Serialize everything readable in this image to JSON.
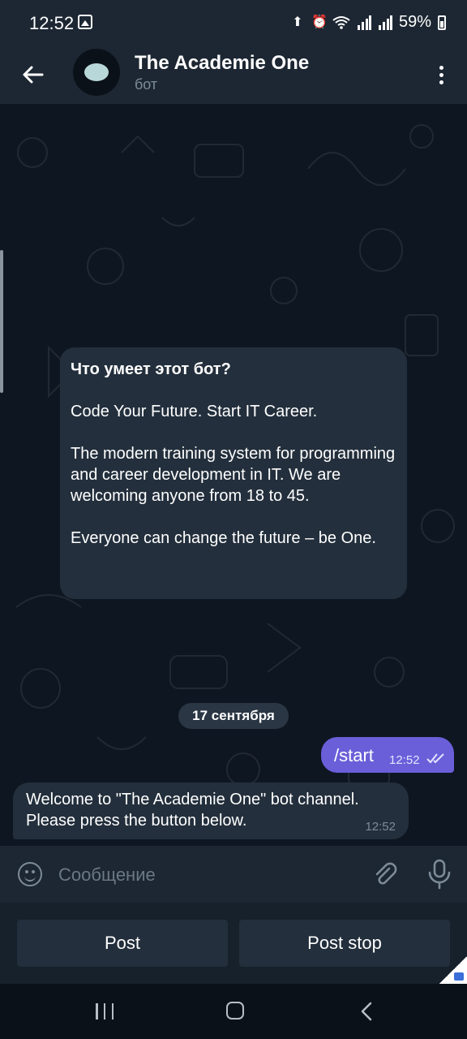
{
  "status_bar": {
    "time": "12:52",
    "battery": "59%"
  },
  "header": {
    "title": "The Academie One",
    "subtitle": "бот"
  },
  "bot_info": {
    "title": "Что умеет этот бот?",
    "paragraphs": [
      "Code Your Future. Start IT Career.",
      "The modern training system for programming and career development in IT. We are welcoming anyone from 18 to 45.",
      "Everyone can change the future – be One."
    ]
  },
  "date_separator": "17 сентября",
  "messages": [
    {
      "direction": "outgoing",
      "text": "/start",
      "time": "12:52",
      "status": "read"
    },
    {
      "direction": "incoming",
      "text": "Welcome to \"The Academie One\" bot channel. Please press the button below.",
      "time": "12:52"
    }
  ],
  "composer": {
    "placeholder": "Сообщение"
  },
  "keyboard": {
    "buttons": [
      "Post",
      "Post stop"
    ]
  },
  "colors": {
    "accent": "#6a5fd9",
    "bubble_in": "#232f3c",
    "header_bg": "#1d2733"
  },
  "icons": [
    "back-arrow-icon",
    "more-vert-icon",
    "emoji-icon",
    "attach-icon",
    "mic-icon",
    "double-check-icon"
  ]
}
